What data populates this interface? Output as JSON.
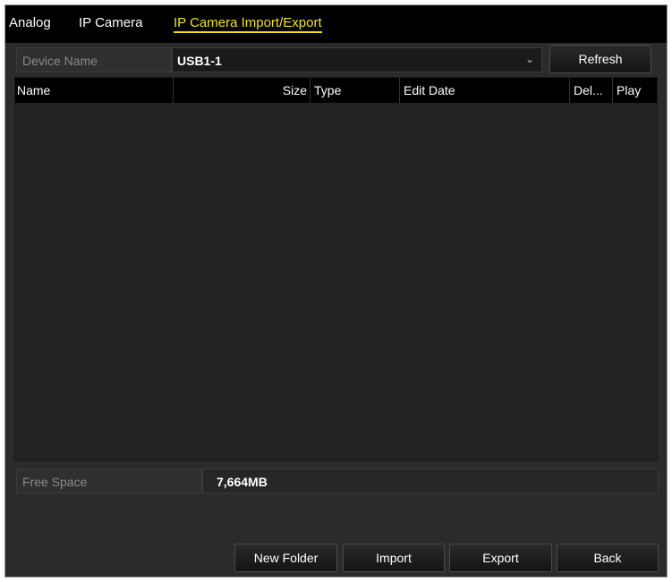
{
  "tabs": [
    {
      "label": "Analog",
      "active": false
    },
    {
      "label": "IP Camera",
      "active": false
    },
    {
      "label": "IP Camera Import/Export",
      "active": true
    }
  ],
  "device": {
    "label": "Device Name",
    "selected": "USB1-1",
    "refresh_label": "Refresh"
  },
  "file_list": {
    "columns": [
      "Name",
      "Size",
      "Type",
      "Edit Date",
      "Del...",
      "Play"
    ],
    "rows": []
  },
  "free_space": {
    "label": "Free Space",
    "value": "7,664MB"
  },
  "buttons": {
    "new_folder": "New Folder",
    "import": "Import",
    "export": "Export",
    "back": "Back"
  },
  "colors": {
    "accent": "#f2e21e",
    "background": "#2b2b2b",
    "header": "#000000"
  }
}
